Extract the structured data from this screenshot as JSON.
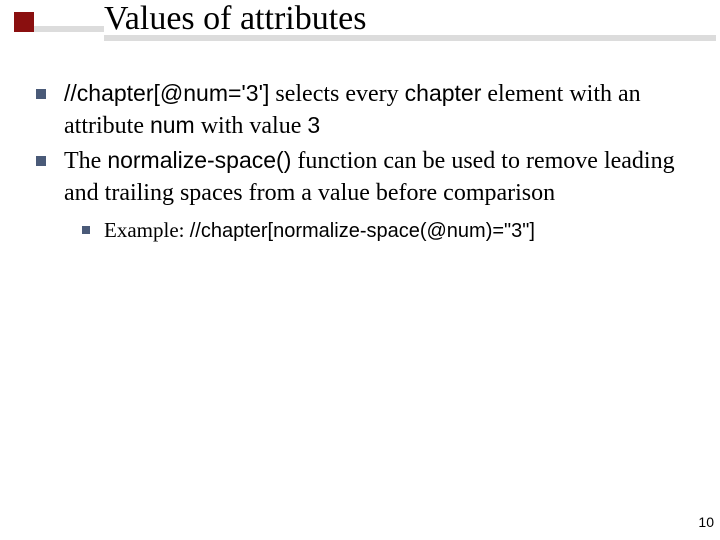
{
  "slide": {
    "title": "Values of attributes",
    "page_number": "10",
    "colors": {
      "accent": "#8a0f0f",
      "bullet": "#4a5a78",
      "rule": "#dcdcdc"
    }
  },
  "bullets": {
    "b1": {
      "code": "//chapter[@num='3']",
      "t1": " selects every ",
      "code2": "chapter",
      "t2": " element with an attribute ",
      "code3": "num",
      "t3": " with value ",
      "code4": "3"
    },
    "b2": {
      "t1": "The ",
      "code": "normalize-space()",
      "t2": " function can be used to remove leading and trailing spaces from a value before comparison"
    },
    "sub1": {
      "label": "Example:  ",
      "code": "//chapter[normalize-space(@num)=\"3\"]"
    }
  }
}
